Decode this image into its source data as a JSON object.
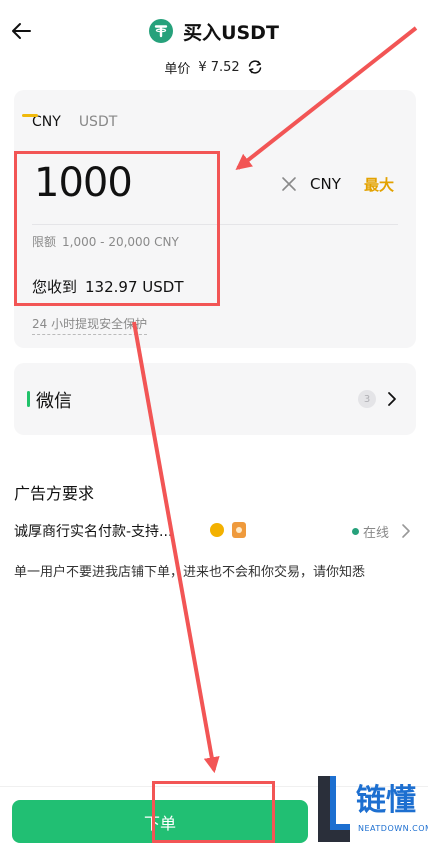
{
  "header": {
    "title": "买入USDT",
    "price_label": "单价",
    "price_value": "¥ 7.52"
  },
  "tabs": [
    {
      "label": "CNY",
      "active": true
    },
    {
      "label": "USDT",
      "active": false
    }
  ],
  "amount_input": {
    "value": "1000",
    "currency": "CNY",
    "max_label": "最大"
  },
  "limit": {
    "label": "限额",
    "value": "1,000 - 20,000 CNY"
  },
  "receive": {
    "label": "您收到",
    "value": "132.97 USDT"
  },
  "protection_text": "24 小时提现安全保护",
  "payment": {
    "method": "微信",
    "count": "3"
  },
  "ad_section": {
    "title": "广告方要求",
    "merchant": "诚厚商行实名付款-支持...",
    "status": "在线",
    "description": "单一用户不要进我店铺下单，进来也不会和你交易，请你知悉"
  },
  "order_button": "下单",
  "watermark": {
    "name": "链懂",
    "domain": "NEATDOWN.COM"
  },
  "colors": {
    "accent_green": "#21bf73",
    "tether_green": "#26a17b",
    "max_yellow": "#e3a200",
    "annotation_red": "#f25555"
  }
}
